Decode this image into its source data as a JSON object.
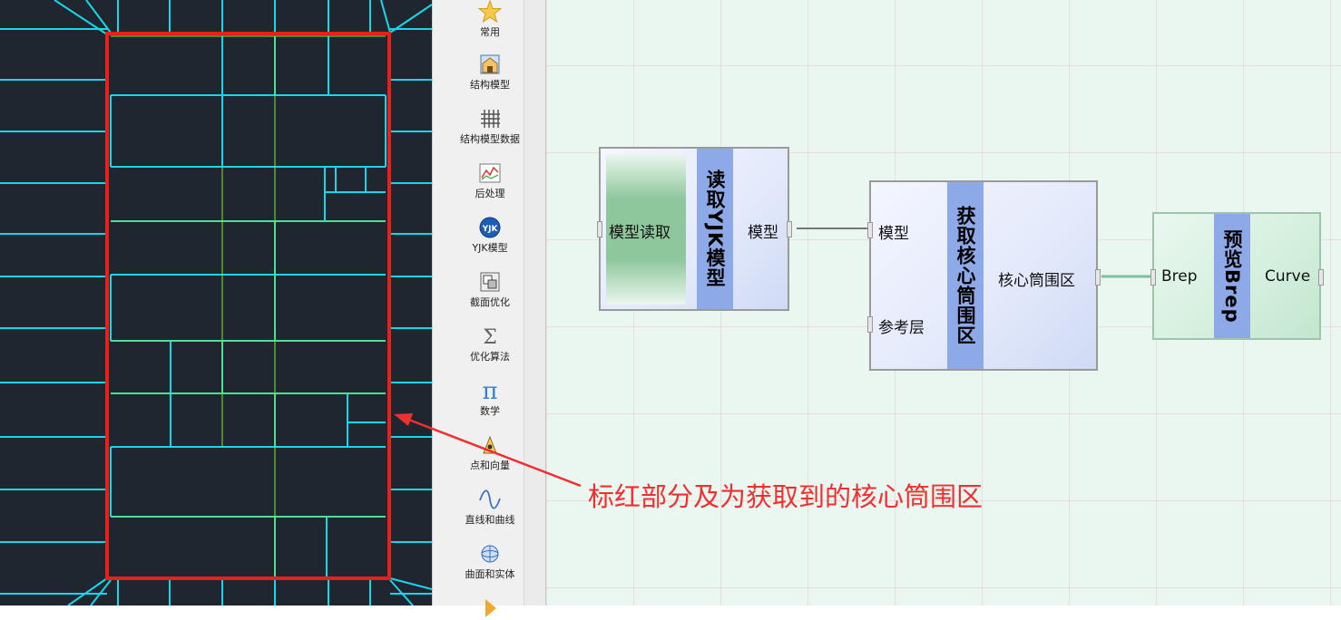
{
  "toolbar": {
    "items": [
      {
        "label": "常用",
        "icon": "star-icon"
      },
      {
        "label": "结构模型",
        "icon": "building-model-icon"
      },
      {
        "label": "结构模型数据",
        "icon": "grid-data-icon"
      },
      {
        "label": "后处理",
        "icon": "post-process-chart-icon"
      },
      {
        "label": "YJK模型",
        "icon": "yjk-logo-icon"
      },
      {
        "label": "截面优化",
        "icon": "section-optimize-icon"
      },
      {
        "label": "优化算法",
        "icon": "sigma-icon"
      },
      {
        "label": "数学",
        "icon": "pi-icon"
      },
      {
        "label": "点和向量",
        "icon": "point-vector-icon"
      },
      {
        "label": "直线和曲线",
        "icon": "curve-icon"
      },
      {
        "label": "曲面和实体",
        "icon": "surface-solid-icon"
      }
    ]
  },
  "nodes": {
    "read": {
      "title": "读取YJK模型",
      "input": "模型读取",
      "output": "模型"
    },
    "core": {
      "title": "获取核心筒围区",
      "input1": "模型",
      "input2": "参考层",
      "output": "核心筒围区"
    },
    "preview": {
      "title": "预览Brep",
      "input": "Brep",
      "output": "Curve"
    }
  },
  "annotation": {
    "text": "标红部分及为获取到的核心筒围区"
  },
  "colors": {
    "highlight": "#e8201a",
    "wall": "#19d7ea",
    "beam": "#7ee83a",
    "annotation": "#f03030"
  }
}
